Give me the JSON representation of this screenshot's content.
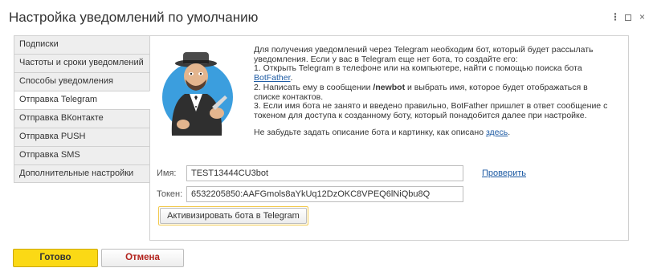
{
  "window": {
    "title": "Настройка уведомлений по умолчанию",
    "controls": {
      "more": "⋮",
      "maximize": "□",
      "close": "×"
    }
  },
  "tabs": [
    {
      "label": "Подписки",
      "active": false
    },
    {
      "label": "Частоты и сроки уведомлений",
      "active": false
    },
    {
      "label": "Способы уведомления",
      "active": false
    },
    {
      "label": "Отправка Telegram",
      "active": true
    },
    {
      "label": "Отправка ВКонтакте",
      "active": false
    },
    {
      "label": "Отправка PUSH",
      "active": false
    },
    {
      "label": "Отправка SMS",
      "active": false
    },
    {
      "label": "Дополнительные настройки",
      "active": false
    }
  ],
  "info": {
    "intro1": "Для получения уведомлений через Telegram необходим бот, который будет рассылать",
    "intro2": "уведомления. Если у вас в Telegram еще нет бота, то создайте его:",
    "step1": "1. Открыть Telegram в телефоне или на компьютере, найти с помощью поиска бота",
    "step1_link": "BotFather",
    "step1_end": ".",
    "step2_a": "2. Написать ему в сообщении ",
    "step2_cmd": "/newbot",
    "step2_b": " и выбрать имя, которое будет отображаться в",
    "step2_c": "списке контактов.",
    "step3_a": "3. Если имя бота не занято и введено правильно, BotFather пришлет в ответ сообщение с",
    "step3_b": "токеном для доступа к созданному боту, который понадобится далее при настройке.",
    "note_a": "Не забудьте задать описание бота и картинку, как описано ",
    "note_link": "здесь",
    "note_end": "."
  },
  "form": {
    "name_label": "Имя:",
    "name_value": "TEST13444CU3bot",
    "check_link": "Проверить",
    "token_label": "Токен:",
    "token_value": "6532205850:AAFGmols8aYkUq12DzOKC8VPEQ6lNiQbu8Q",
    "activate_button": "Активизировать бота в Telegram"
  },
  "footer": {
    "ok_button": "Готово",
    "cancel_button": "Отмена"
  },
  "colors": {
    "accent_yellow": "#fbd915",
    "cancel_red": "#b2221c",
    "link_blue": "#1c5aa3"
  }
}
